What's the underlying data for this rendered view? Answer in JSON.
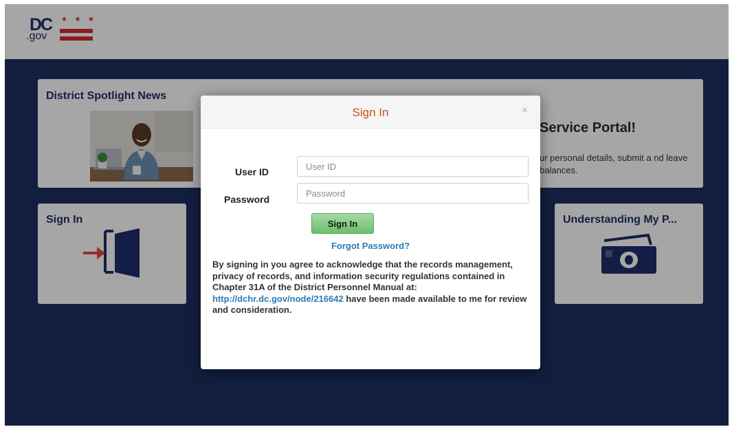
{
  "logo": {
    "dc": "DC",
    "gov": ".gov",
    "stars": [
      "★",
      "★",
      "★"
    ]
  },
  "tiles": {
    "spotlight": {
      "title": "District Spotlight News"
    },
    "portal": {
      "title_visible": "Service Portal!",
      "description_visible": "ur personal details, submit a nd leave balances."
    },
    "signin": {
      "title": "Sign In"
    },
    "understanding_pay": {
      "title": "Understanding My P..."
    }
  },
  "modal": {
    "title": "Sign In",
    "close": "×",
    "user_label": "User ID",
    "user_placeholder": "User ID",
    "user_value": "",
    "password_label": "Password",
    "password_placeholder": "Password",
    "password_value": "",
    "submit_label": "Sign In",
    "forgot_label": "Forgot Password?",
    "notice_before": "By signing in you agree to acknowledge that the records management, privacy of records, and information security regulations contained in Chapter 31A of the District Personnel Manual at: ",
    "notice_link": "http://dchr.dc.gov/node/216642",
    "notice_after": " have been made available to me for review and consideration."
  },
  "colors": {
    "page_background": "#1e2f62",
    "title_navy": "#1f2d6b",
    "logo_red": "#d42a2f",
    "modal_title": "#c4540f",
    "link_blue": "#2d7ab2",
    "button_green": "#6cbf6b"
  },
  "icons": {
    "signin_tile": "door-enter-icon",
    "pay_tile": "money-bill-icon",
    "close": "close-icon"
  }
}
